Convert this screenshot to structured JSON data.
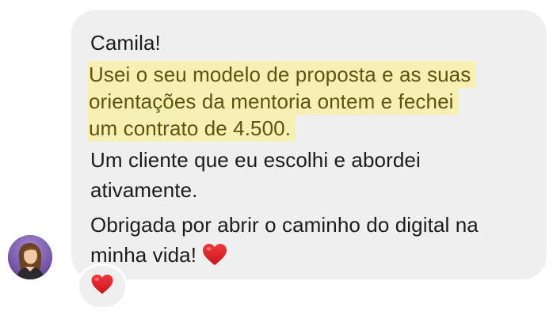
{
  "message": {
    "greeting": "Camila!",
    "highlighted_lines": [
      "Usei o seu modelo de proposta e as suas",
      "orientações da mentoria ontem e fechei",
      "um contrato de 4.500."
    ],
    "paragraph2_lines": [
      "Um cliente que eu escolhi e abordei",
      "ativamente."
    ],
    "paragraph3_lines": [
      "Obrigada por abrir o caminho do digital na",
      "minha vida!"
    ],
    "inline_emoji": "heart-icon"
  },
  "reaction": {
    "emoji": "heart-icon"
  },
  "colors": {
    "bubble": "#efefef",
    "highlight": "#f6f0b3",
    "highlight_text": "#5d5414",
    "text": "#1b1b1b",
    "heart": "#e0262b"
  }
}
